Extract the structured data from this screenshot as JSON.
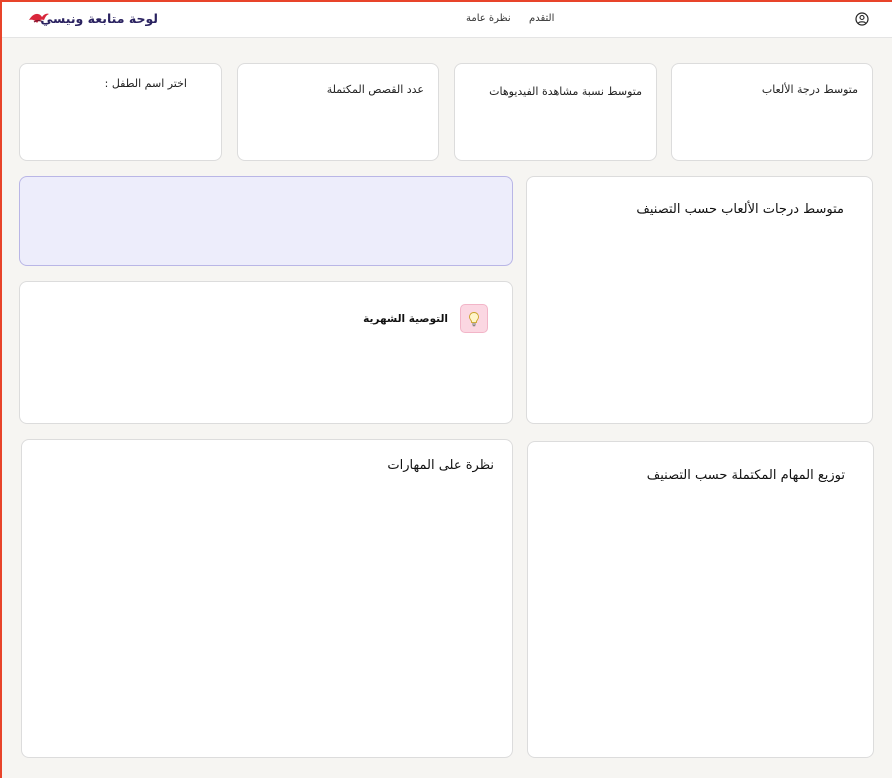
{
  "header": {
    "brand_title": "لوحة متابعة ونيسي",
    "nav": {
      "progress": "التقدم",
      "overview": "نظرة عامة"
    }
  },
  "kpis": {
    "avg_game_score": "متوسط درجة الألعاب",
    "avg_video_watch": "متوسط نسبة مشاهدة الفيديوهات",
    "completed_stories": "عدد القصص المكتملة",
    "choose_child": "اختر اسم الطفل :"
  },
  "sections": {
    "games_by_category": "متوسط درجات الألعاب حسب التصنيف",
    "monthly_recommendation": "التوصية الشهرية",
    "tasks_by_category": "توزيع المهام المكتملة حسب التصنيف",
    "skills_overview": "نظرة على المهارات"
  },
  "colors": {
    "brand_text": "#2a2260",
    "logo_red": "#d9263b",
    "banner_bg": "#ededfb",
    "rec_icon_bg": "#fbd7e2"
  },
  "icons": {
    "logo": "bird-logo-icon",
    "user": "user-circle-icon",
    "recommendation": "lightbulb-icon"
  }
}
